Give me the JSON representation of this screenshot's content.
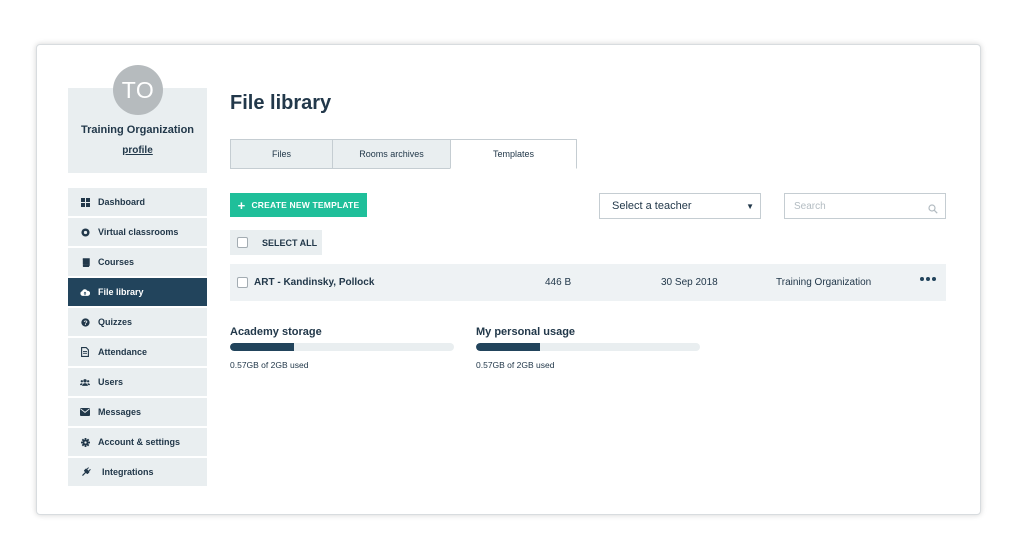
{
  "profile": {
    "initials": "TO",
    "org_name": "Training Organization",
    "profile_link": "profile"
  },
  "nav": {
    "items": [
      {
        "label": "Dashboard",
        "icon": "grid-icon"
      },
      {
        "label": "Virtual classrooms",
        "icon": "record-icon"
      },
      {
        "label": "Courses",
        "icon": "book-icon"
      },
      {
        "label": "File library",
        "icon": "cloud-upload-icon",
        "active": true
      },
      {
        "label": "Quizzes",
        "icon": "question-icon"
      },
      {
        "label": "Attendance",
        "icon": "document-icon"
      },
      {
        "label": "Users",
        "icon": "users-icon"
      },
      {
        "label": "Messages",
        "icon": "envelope-icon"
      },
      {
        "label": "Account & settings",
        "icon": "gear-icon"
      },
      {
        "label": "Integrations",
        "icon": "plug-icon"
      }
    ]
  },
  "page": {
    "title": "File library"
  },
  "tabs": [
    {
      "label": "Files"
    },
    {
      "label": "Rooms archives"
    },
    {
      "label": "Templates",
      "active": true
    }
  ],
  "toolbar": {
    "create_label": "CREATE NEW TEMPLATE",
    "teacher_select": "Select a teacher",
    "search_placeholder": "Search",
    "select_all_label": "SELECT ALL"
  },
  "files": [
    {
      "name": "ART - Kandinsky, Pollock",
      "size": "446 B",
      "date": "30 Sep 2018",
      "owner": "Training Organization"
    }
  ],
  "storage": {
    "academy": {
      "title": "Academy storage",
      "used_text": "0.57GB of 2GB used",
      "fraction": 0.285
    },
    "personal": {
      "title": "My personal usage",
      "used_text": "0.57GB of 2GB used",
      "fraction": 0.285
    }
  },
  "colors": {
    "accent": "#1fbf9a",
    "nav_active": "#22445c",
    "text": "#22384a",
    "panel": "#e9eef0"
  }
}
